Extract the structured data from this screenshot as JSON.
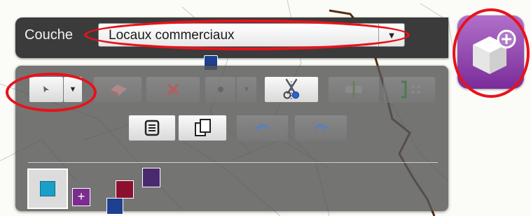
{
  "toolbar": {
    "layer_label": "Couche",
    "layer_value": "Locaux commerciaux"
  },
  "icons": {
    "select_tool": "arrow-pointer-icon",
    "dropdown": "chevron-down-icon",
    "eraser": "eraser-icon",
    "delete": "delete-x-icon",
    "point": "point-icon",
    "cut": "scissors-icon",
    "split": "split-icon",
    "merge": "merge-icon",
    "attributes": "attributes-table-icon",
    "copy": "copy-icon",
    "undo": "undo-icon",
    "redo": "redo-icon",
    "add": "add-cube-icon"
  },
  "colors": {
    "highlight_ring": "#e8121b",
    "add_tile": "#9b4bb8",
    "symbol_fill": "#1aa0c8"
  }
}
